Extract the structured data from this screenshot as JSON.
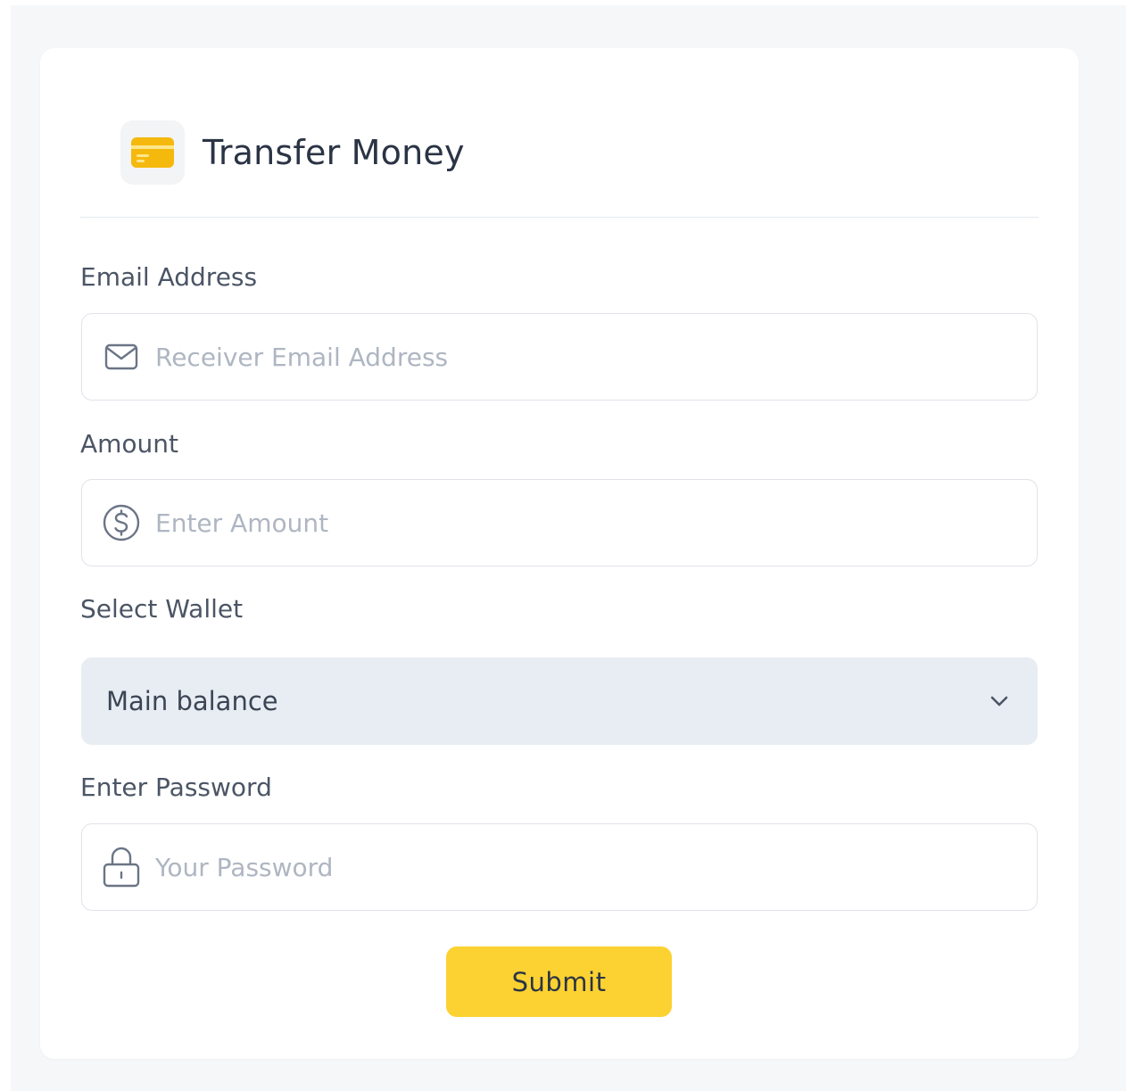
{
  "header": {
    "title": "Transfer Money",
    "icon": "credit-card-icon"
  },
  "form": {
    "email": {
      "label": "Email Address",
      "placeholder": "Receiver Email Address",
      "value": "",
      "icon": "mail-icon"
    },
    "amount": {
      "label": "Amount",
      "placeholder": "Enter Amount",
      "value": "",
      "icon": "dollar-circle-icon"
    },
    "wallet": {
      "label": "Select Wallet",
      "selected": "Main balance",
      "icon": "chevron-down-icon"
    },
    "password": {
      "label": "Enter Password",
      "placeholder": "Your Password",
      "value": "",
      "icon": "lock-icon"
    },
    "submit_label": "Submit"
  },
  "colors": {
    "accent": "#fcd232",
    "icon_accent": "#f5b80d",
    "page_background": "#f6f7f9",
    "card_background": "#ffffff",
    "select_background": "#e8edf3"
  }
}
